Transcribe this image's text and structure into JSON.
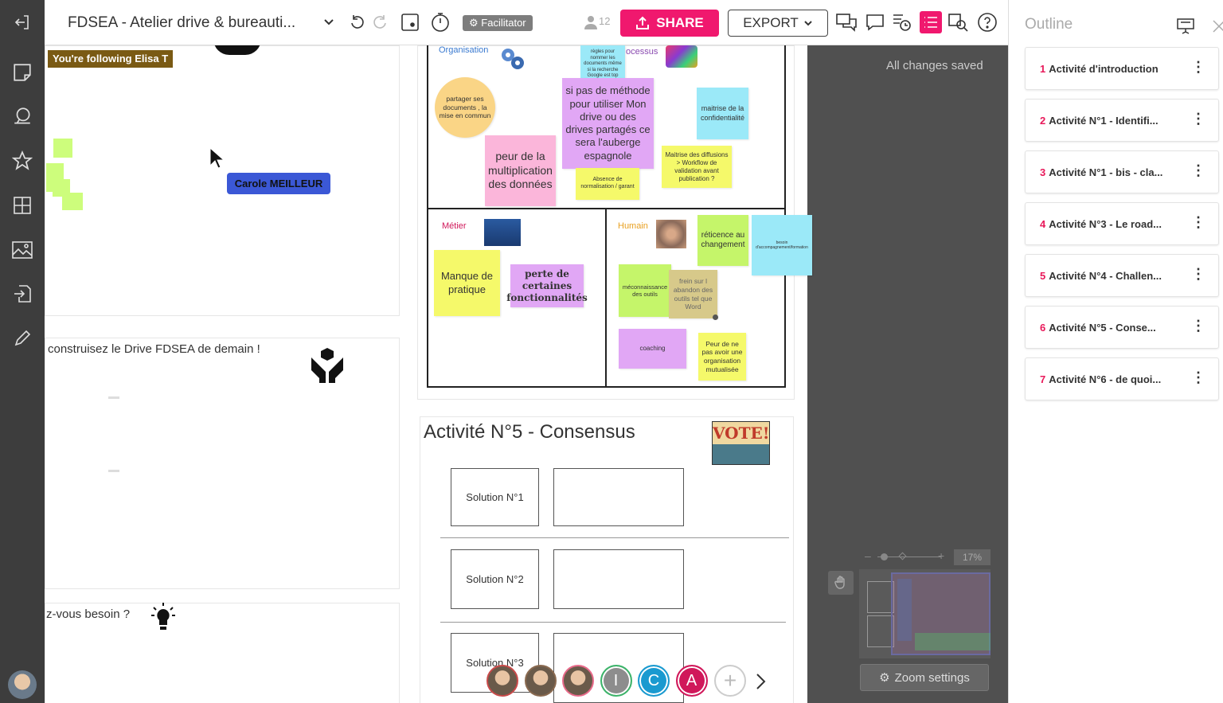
{
  "window": {
    "title": "FDSEA - Atelier drive & bureauti..."
  },
  "toolbar": {
    "facilitator_label": "Facilitator",
    "users_count": "12",
    "share_label": "SHARE",
    "export_label": "EXPORT"
  },
  "canvas": {
    "save_status": "All changes saved",
    "following_label": "You're following Elisa T",
    "cursor_user": "Carole MEILLEUR",
    "left_frame_texts": [
      "construisez le Drive FDSEA de demain !",
      "z-vous besoin ?"
    ],
    "sections": {
      "organisation": "Organisation",
      "processus": "ocessus",
      "metier": "Métier",
      "humain": "Humain"
    },
    "stickies": {
      "regles": "règles pour nommer les documents même si la recherche Google est top",
      "partager": "partager ses documents , la mise en commun",
      "methode": "si pas de méthode pour utiliser Mon drive ou des drives partagés ce sera l'auberge espagnole",
      "confidentialite": "maitrise de la confidentialité",
      "peur_multi": "peur de la multiplication des données",
      "absence_norm": "Absence de normalisation / garant",
      "maitrise_diff": "Maitrise des diffusions > Workflow de validation avant publication ?",
      "manque_pratique": "Manque de pratique",
      "perte_fonc": "perte de certaines fonctionnalités",
      "reticence": "réticence au changement",
      "besoin_accomp": "besoin d'accompagnement/formation",
      "meconnaissance": "méconnaissance des outils",
      "frein": "frein sur l abandon des outils tel que Word",
      "coaching": "coaching",
      "peur_orga": "Peur de ne pas avoir une organisation mutualisée"
    },
    "consensus": {
      "title": "Activité N°5 - Consensus",
      "vote_label": "VOTE!",
      "solutions": [
        "Solution N°1",
        "Solution N°2",
        "Solution N°3"
      ]
    },
    "zoom": {
      "level": "17%",
      "settings_label": "Zoom settings"
    }
  },
  "participants": [
    {
      "type": "photo",
      "color": "#c94a4a"
    },
    {
      "type": "photo",
      "color": "#8a6a50"
    },
    {
      "type": "photo",
      "color": "#e86a8a"
    },
    {
      "type": "initial",
      "label": "I",
      "color": "#8d8d8d",
      "ring": "#3cb46a"
    },
    {
      "type": "initial",
      "label": "C",
      "color": "#1a9ad0",
      "ring": "#1a9ad0"
    },
    {
      "type": "initial",
      "label": "A",
      "color": "#d0185a",
      "ring": "#d0185a"
    }
  ],
  "outline": {
    "title": "Outline",
    "items": [
      {
        "num": "1",
        "label": "Activité d'introduction"
      },
      {
        "num": "2",
        "label": "Activité N°1 - Identifi..."
      },
      {
        "num": "3",
        "label": "Activité N°1 - bis - cla..."
      },
      {
        "num": "4",
        "label": "Activité N°3 - Le road..."
      },
      {
        "num": "5",
        "label": "Activité N°4 - Challen..."
      },
      {
        "num": "6",
        "label": "Activité N°5 - Conse..."
      },
      {
        "num": "7",
        "label": "Activité N°6 - de quoi..."
      }
    ]
  },
  "colors": {
    "accent": "#f0186e",
    "sidebar": "#3d3d3d",
    "cursor_tag": "#3b58d6",
    "following_tag": "#7a5a14"
  }
}
